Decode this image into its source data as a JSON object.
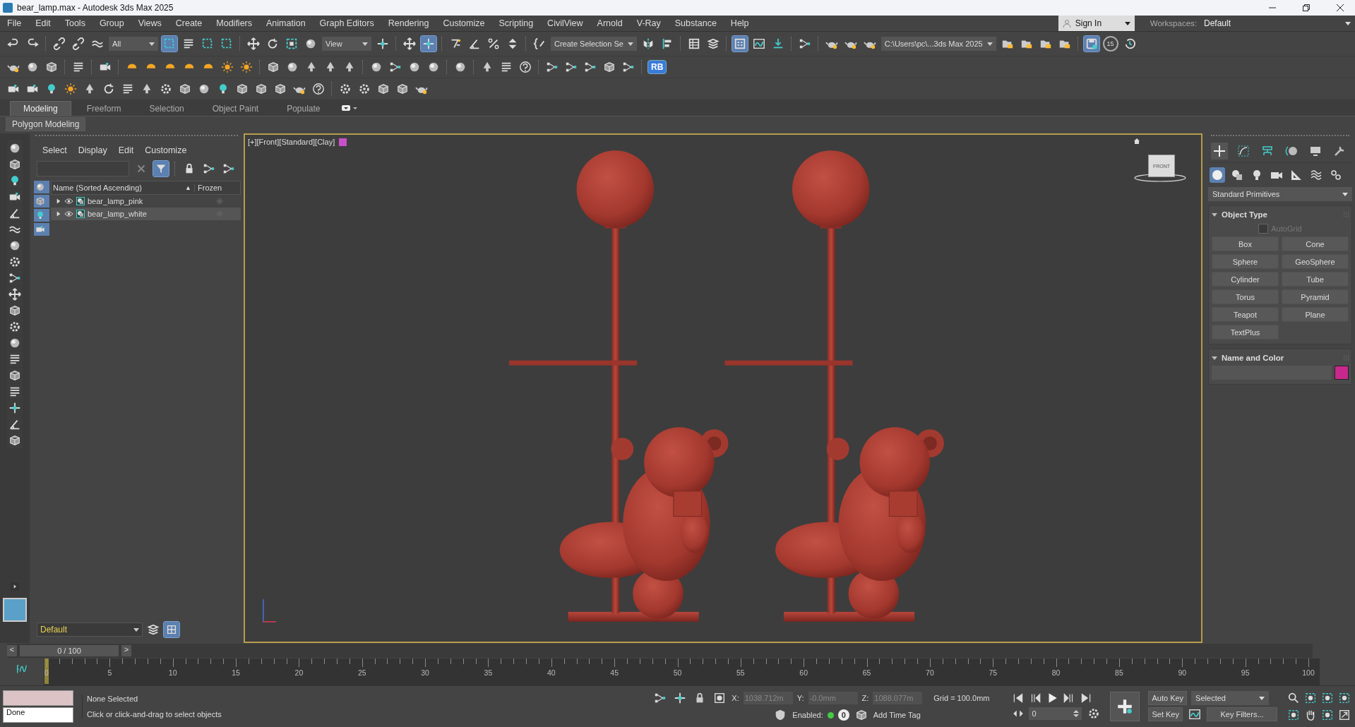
{
  "window": {
    "title": "bear_lamp.max - Autodesk 3ds Max 2025"
  },
  "menu": [
    "File",
    "Edit",
    "Tools",
    "Group",
    "Views",
    "Create",
    "Modifiers",
    "Animation",
    "Graph Editors",
    "Rendering",
    "Customize",
    "Scripting",
    "CivilView",
    "Arnold",
    "V-Ray",
    "Substance",
    "Help"
  ],
  "account": {
    "label": "Sign In"
  },
  "workspaces": {
    "label": "Workspaces:",
    "value": "Default"
  },
  "toolbar": {
    "selection_filter": "All",
    "reference_coordinate": "View",
    "named_selection": "Create Selection Se",
    "project_path": "C:\\Users\\pc\\...3ds Max 2025",
    "autobackup_count": "15",
    "rb_button": "RB",
    "states": {
      "select_object": true,
      "keyboard_override": true,
      "ribbon": true,
      "autobackup": true
    }
  },
  "ribbon": {
    "tabs": [
      {
        "label": "Modeling",
        "selected": true
      },
      {
        "label": "Freeform",
        "selected": false
      },
      {
        "label": "Selection",
        "selected": false
      },
      {
        "label": "Object Paint",
        "selected": false
      },
      {
        "label": "Populate",
        "selected": false
      }
    ],
    "panel": "Polygon Modeling"
  },
  "scene_explorer": {
    "menu": [
      "Select",
      "Display",
      "Edit",
      "Customize"
    ],
    "filter_active": true,
    "columns": [
      "Name (Sorted Ascending)",
      "Frozen"
    ],
    "sort_mark": "▲",
    "rows": [
      {
        "name": "bear_lamp_pink",
        "expanded": false,
        "selected": false
      },
      {
        "name": "bear_lamp_white",
        "expanded": false,
        "selected": true
      }
    ],
    "layer": "Default"
  },
  "viewport": {
    "label": "[+][Front][Standard][Clay]",
    "viewcube": "FRONT",
    "active": true
  },
  "command_panel": {
    "tabs": [
      {
        "selected": true
      },
      {
        "selected": false
      },
      {
        "selected": false
      },
      {
        "selected": false
      },
      {
        "selected": false
      },
      {
        "selected": false
      }
    ],
    "categories": [
      {
        "selected": true
      },
      {
        "selected": false
      },
      {
        "selected": false
      },
      {
        "selected": false
      },
      {
        "selected": false
      },
      {
        "selected": false
      },
      {
        "selected": false
      }
    ],
    "category": "Standard Primitives",
    "object_type": {
      "title": "Object Type",
      "expanded": true,
      "autogrid": {
        "label": "AutoGrid",
        "checked": false,
        "disabled": true
      },
      "buttons": [
        "Box",
        "Cone",
        "Sphere",
        "GeoSphere",
        "Cylinder",
        "Tube",
        "Torus",
        "Pyramid",
        "Teapot",
        "Plane",
        "TextPlus"
      ]
    },
    "name_and_color": {
      "title": "Name and Color",
      "expanded": true,
      "color": "#c8288c"
    }
  },
  "timeline": {
    "level": 0,
    "prev": "<",
    "frame": "0 / 100",
    "next": ">",
    "ticks": [
      "0",
      "5",
      "10",
      "15",
      "20",
      "25",
      "30",
      "35",
      "40",
      "45",
      "50",
      "55",
      "60",
      "65",
      "70",
      "75",
      "80",
      "85",
      "90",
      "95",
      "100"
    ]
  },
  "status": {
    "script_output": "Done",
    "selection": "None Selected",
    "prompt": "Click or click-and-drag to select objects",
    "x_label": "X:",
    "x": "1038.712m",
    "y_label": "Y:",
    "y": "-0.0mm",
    "z_label": "Z:",
    "z": "1088.077m",
    "grid": "Grid = 100.0mm",
    "enabled_label": "Enabled:",
    "enabled": true,
    "time_tag_count": "0",
    "time_tag": "Add Time Tag",
    "current_frame": "0",
    "auto_key": "Auto Key",
    "set_key": "Set Key",
    "key_mode": "Selected",
    "key_filters": "Key Filters..."
  }
}
